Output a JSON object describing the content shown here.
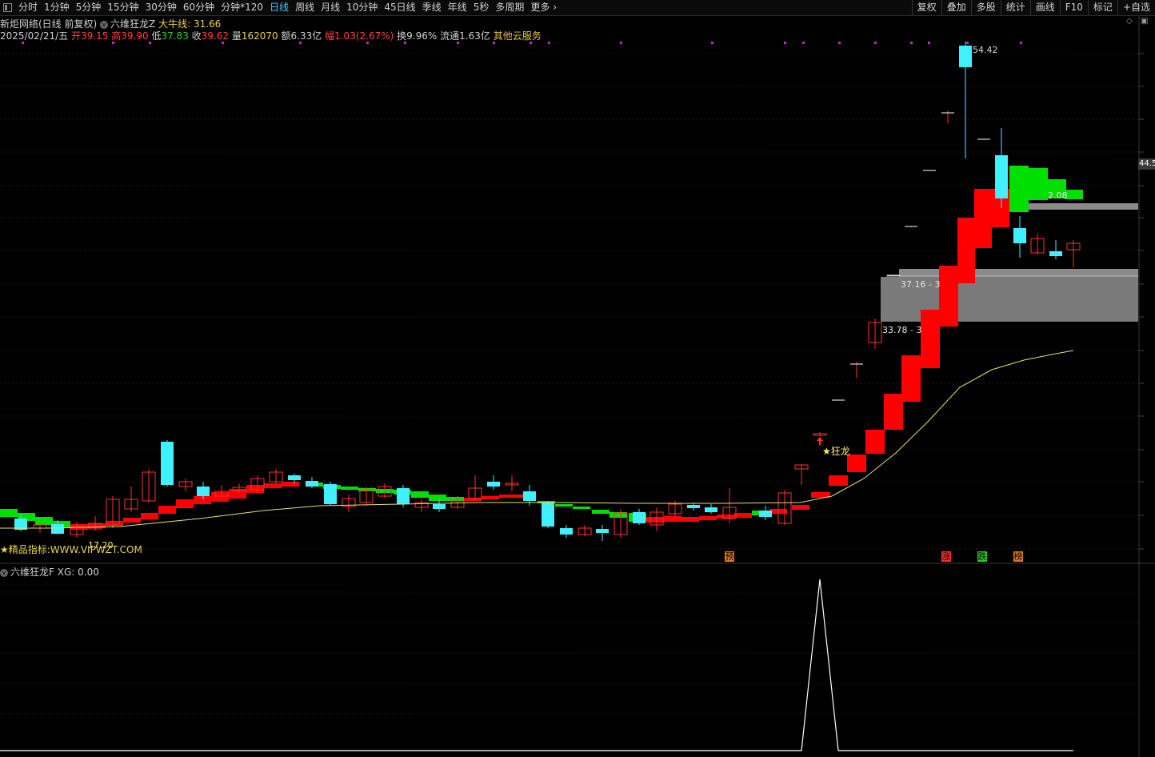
{
  "toolbar": {
    "periods": [
      "分时",
      "1分钟",
      "5分钟",
      "15分钟",
      "30分钟",
      "60分钟",
      "分钟*120",
      "日线",
      "周线",
      "月线",
      "10分钟",
      "45日线",
      "季线",
      "年线",
      "5秒",
      "多周期",
      "更多"
    ],
    "active_period": "日线",
    "right_buttons": [
      "复权",
      "叠加",
      "多股",
      "统计",
      "画线",
      "F10",
      "标记",
      "+自选"
    ]
  },
  "header": {
    "source": "新炬网络(日线 前复权)",
    "indicator_name": "六维狂龙Z",
    "indicator_line_label": "大牛线:",
    "indicator_line_value": "31.66"
  },
  "quote": {
    "date": "2025/02/21/五",
    "open_label": "开",
    "open": "39.15",
    "high_label": "高",
    "high": "39.90",
    "low_label": "低",
    "low": "37.83",
    "close_label": "收",
    "close": "39.62",
    "volume_label": "量",
    "volume": "162070",
    "amount_label": "额",
    "amount": "6.33亿",
    "change_label": "幅",
    "change": "1.03(2.67%)",
    "turnover_label": "换",
    "turnover": "9.96%",
    "float_label": "流通",
    "float": "1.63亿",
    "service": "其他云服务"
  },
  "main_chart": {
    "price_tag": "44.5",
    "annotations": {
      "high": "54.42",
      "zone_upper": "37.16 - 3",
      "zone_lower": "33.78 - 3",
      "right_label": "2.08",
      "low_label": "17.20",
      "signal": "★狂龙"
    },
    "footer_text": "★精品指标:WWW.VIPWZT.COM",
    "markers": [
      {
        "text": "预",
        "color": "#e07a20"
      },
      {
        "text": "涨",
        "color": "#ff3030"
      },
      {
        "text": "跌",
        "color": "#20d020"
      },
      {
        "text": "榜",
        "color": "#e07a20"
      }
    ]
  },
  "sub_chart": {
    "indicator_name": "六维狂龙F",
    "label": "XG:",
    "value": "0.00"
  },
  "colors": {
    "up": "#ff2020",
    "down": "#40f0ff",
    "ribbon_up": "#ff0000",
    "ribbon_down": "#00e000",
    "ma_line": "#e8e070",
    "grid": "#1c1c1c",
    "zone": "#808080"
  }
}
